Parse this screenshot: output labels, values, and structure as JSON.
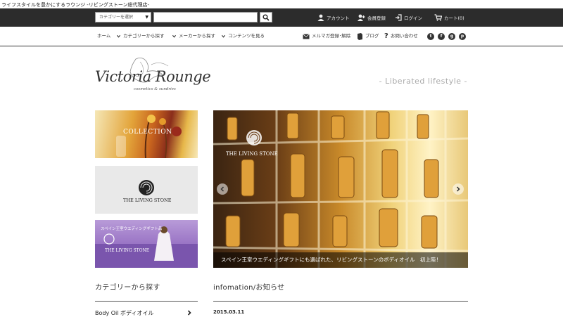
{
  "tagline": "ライフスタイルを豊かにするラウンジ -リビングストーン総代理店-",
  "header": {
    "category_select": "カテゴリーを選択",
    "search_placeholder": "",
    "links": {
      "account": "アカウント",
      "register": "会員登録",
      "login": "ログイン",
      "cart": "カート(0)"
    }
  },
  "nav": {
    "home": "ホーム",
    "by_category": "カテゴリーから探す",
    "by_maker": "メーカーから探す",
    "contents": "コンテンツを見る",
    "newsletter": "メルマガ登録･解除",
    "blog": "ブログ",
    "contact": "お問い合わせ",
    "social": [
      "twitter-icon",
      "facebook-icon",
      "googleplus-icon",
      "pinterest-icon"
    ]
  },
  "logo": {
    "name": "Victoria Rounge",
    "sub": "cosmetics & sundries"
  },
  "slogan": "- Liberated lifestyle -",
  "banners": {
    "collection": "COLLECTION",
    "living_stone": "THE LIVING STONE",
    "wedding_title": "スペイン王室ウエディングギフト品",
    "wedding_brand": "THE LIVING STONE"
  },
  "hero": {
    "brand": "THE LIVING STONE",
    "caption": "スペイン王室ウエディングギフトにも選ばれた、リビングストーンのボディオイル　初上陸！"
  },
  "sections": {
    "category_title": "カテゴリーから探す",
    "category_items": [
      {
        "label": "Body Oil ボディオイル"
      }
    ],
    "news_title": "infomation/お知らせ",
    "news_items": [
      {
        "date": "2015.03.11"
      }
    ]
  },
  "colors": {
    "topbar": "#2c2c2c",
    "caption_bg": "rgba(0,0,0,0.55)",
    "slogan": "#aaaaaa"
  }
}
